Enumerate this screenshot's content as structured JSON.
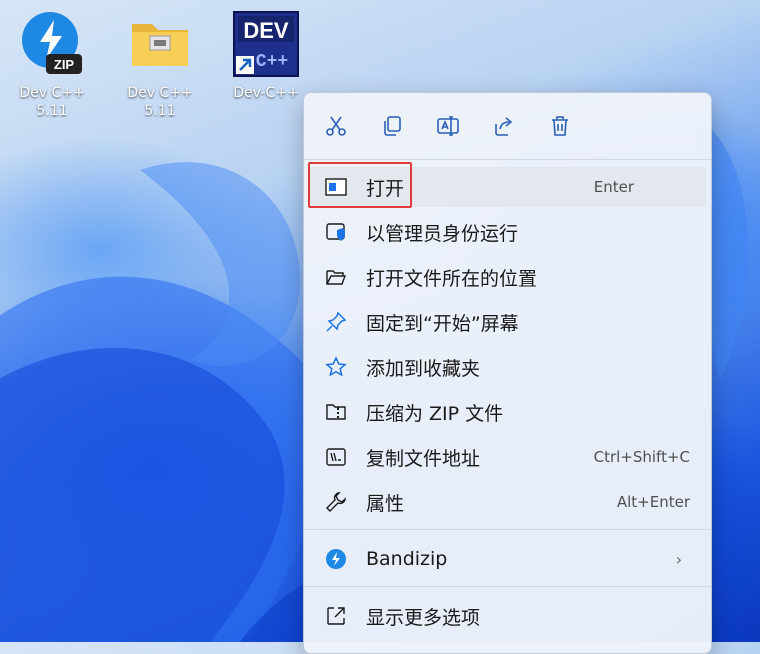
{
  "desktop": {
    "icons": [
      {
        "label_line1": "Dev C++",
        "label_line2": "5.11",
        "icon": "bandizip-zip-icon"
      },
      {
        "label_line1": "Dev C++",
        "label_line2": "5.11",
        "icon": "folder-icon"
      },
      {
        "label_line1": "Dev-C++",
        "label_line2": "",
        "icon": "devcpp-shortcut-icon",
        "logo_text": "DEV",
        "logo_sub": "C++"
      }
    ],
    "zip_badge": "ZIP"
  },
  "context_menu": {
    "toolbar": [
      "cut-icon",
      "copy-icon",
      "rename-icon",
      "share-icon",
      "delete-icon"
    ],
    "items": [
      {
        "label": "打开",
        "shortcut": "Enter",
        "icon": "open-app-icon"
      },
      {
        "label": "以管理员身份运行",
        "shortcut": "",
        "icon": "admin-shield-icon"
      },
      {
        "label": "打开文件所在的位置",
        "shortcut": "",
        "icon": "folder-open-icon"
      },
      {
        "label": "固定到“开始”屏幕",
        "shortcut": "",
        "icon": "pin-icon"
      },
      {
        "label": "添加到收藏夹",
        "shortcut": "",
        "icon": "star-icon"
      },
      {
        "label": "压缩为 ZIP 文件",
        "shortcut": "",
        "icon": "zip-folder-icon"
      },
      {
        "label": "复制文件地址",
        "shortcut": "Ctrl+Shift+C",
        "icon": "copy-path-icon"
      },
      {
        "label": "属性",
        "shortcut": "Alt+Enter",
        "icon": "wrench-icon"
      },
      {
        "label": "Bandizip",
        "shortcut": "",
        "icon": "bandizip-icon",
        "submenu": "›"
      },
      {
        "label": "显示更多选项",
        "shortcut": "",
        "icon": "more-options-icon"
      }
    ]
  },
  "colors": {
    "highlight_border": "#e23b3b",
    "accent_blue": "#1a73e8"
  }
}
